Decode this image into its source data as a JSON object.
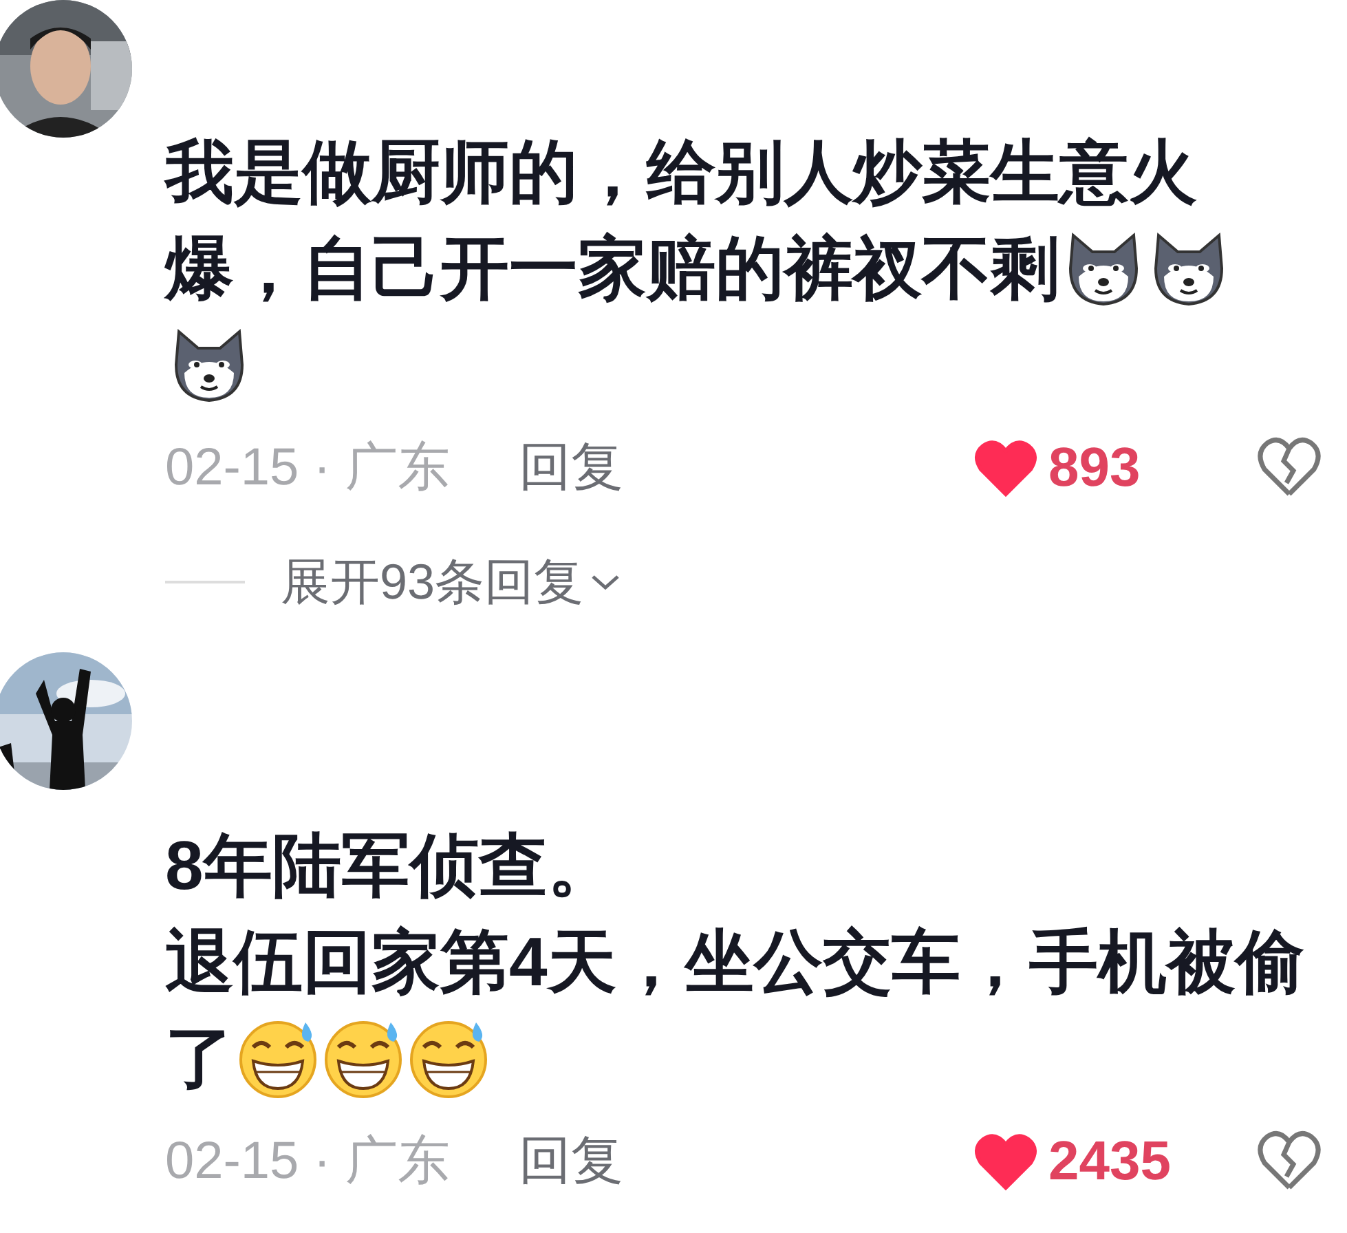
{
  "comments": [
    {
      "lines": [
        {
          "text": "我是做厨师的，给别人炒菜生意火"
        },
        {
          "text": "爆，自己开一家赔的裤衩不剩",
          "emojis": [
            {
              "kind": "dog"
            },
            {
              "kind": "dog"
            }
          ]
        },
        {
          "emojis": [
            {
              "kind": "dog"
            }
          ]
        }
      ],
      "meta": "02-15 · 广东",
      "reply": "回复",
      "liked": true,
      "likes": "893",
      "expand": "展开93条回复"
    },
    {
      "lines": [
        {
          "text": "8年陆军侦查。"
        },
        {
          "text": "退伍回家第4天，坐公交车，手机被偷"
        },
        {
          "text": "了",
          "emojis": [
            {
              "kind": "grin-sweat"
            },
            {
              "kind": "grin-sweat"
            },
            {
              "kind": "grin-sweat"
            }
          ]
        }
      ],
      "meta": "02-15 · 广东",
      "reply": "回复",
      "liked": true,
      "likes": "2435"
    }
  ]
}
